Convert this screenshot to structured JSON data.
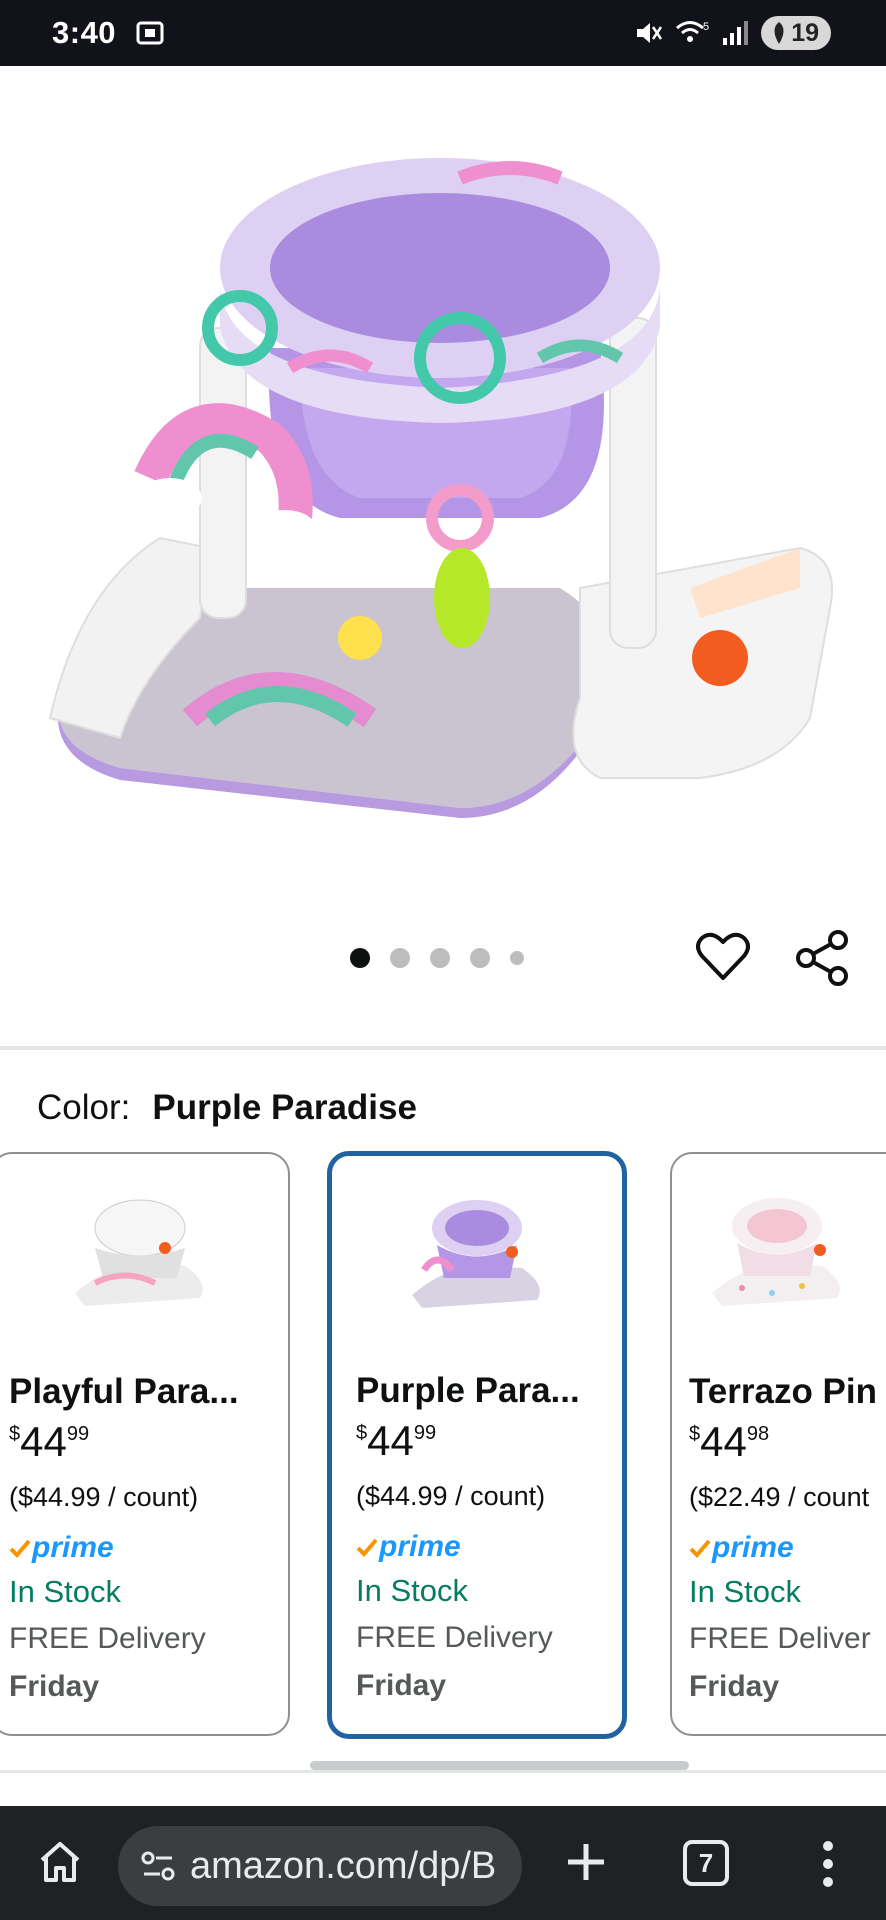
{
  "status_bar": {
    "time": "3:40",
    "wifi_label": "5",
    "battery_level": "19",
    "icons": [
      "screenshot-icon",
      "mute-icon",
      "wifi-icon",
      "signal-icon",
      "battery-icon"
    ]
  },
  "product": {
    "image_description_icon": "baby-floor-seat-image",
    "carousel": {
      "dot_count": 5,
      "active_index": 0
    }
  },
  "color": {
    "label": "Color:",
    "value": "Purple Paradise"
  },
  "swatches": [
    {
      "name": "Playful Para...",
      "price_symbol": "$",
      "price_whole": "44",
      "price_fraction": "99",
      "unit_price": "($44.99 / count)",
      "prime": "prime",
      "stock": "In Stock",
      "delivery": "FREE Delivery",
      "delivery_day": "Friday",
      "selected": false,
      "accent": "#f6a5c0"
    },
    {
      "name": "Purple Para...",
      "price_symbol": "$",
      "price_whole": "44",
      "price_fraction": "99",
      "unit_price": "($44.99 / count)",
      "prime": "prime",
      "stock": "In Stock",
      "delivery": "FREE Delivery",
      "delivery_day": "Friday",
      "selected": true,
      "accent": "#b99be0"
    },
    {
      "name": "Terrazo Pin",
      "price_symbol": "$",
      "price_whole": "44",
      "price_fraction": "98",
      "unit_price": "($22.49 / count",
      "prime": "prime",
      "stock": "In Stock",
      "delivery": "FREE Deliver",
      "delivery_day": "Friday",
      "selected": false,
      "accent": "#f4c6d3"
    }
  ],
  "browser": {
    "url": "amazon.com/dp/B",
    "tab_count": "7"
  },
  "colors": {
    "selected_border": "#2162a1",
    "stock_green": "#067d62",
    "prime_blue": "#1a98ff",
    "prime_check": "#f79400"
  }
}
